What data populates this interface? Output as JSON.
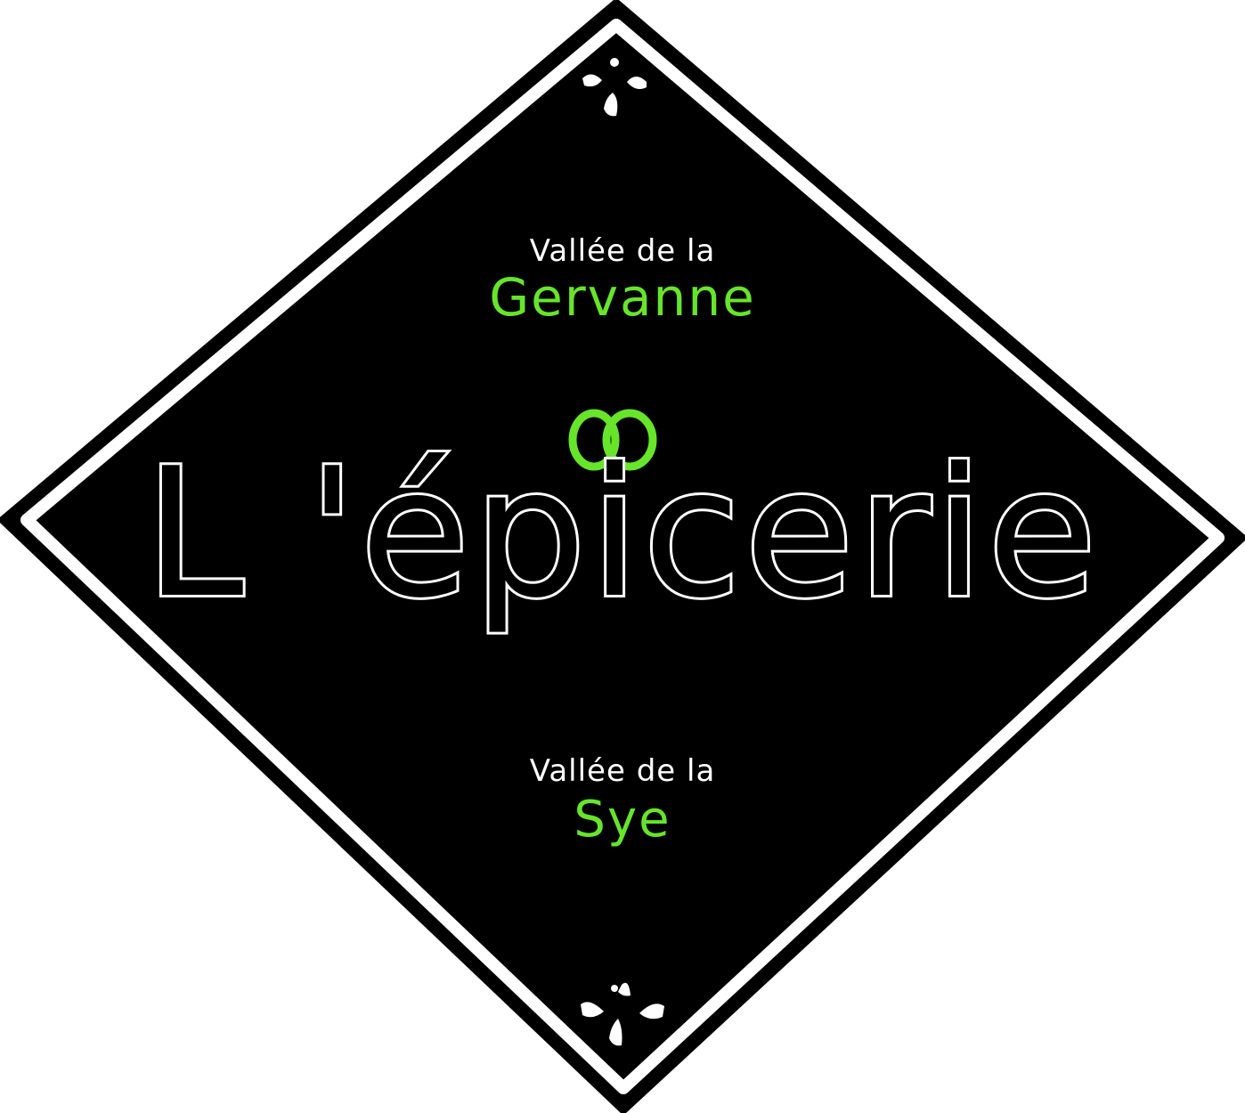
{
  "sign": {
    "top_line1": "Vallée de la",
    "top_line2": "Gervanne",
    "main_title": "L 'épicerie",
    "bottom_line1": "Vallée de la",
    "bottom_line2": "Sye"
  },
  "colors": {
    "background": "#ffffff",
    "board": "#000000",
    "text_white": "#ffffff",
    "accent_green": "#66e52a"
  },
  "icons": {
    "top_ornament": "fleur-ornament-icon",
    "bottom_ornament": "fleur-ornament-icon",
    "rings": "interlocking-rings-icon"
  }
}
